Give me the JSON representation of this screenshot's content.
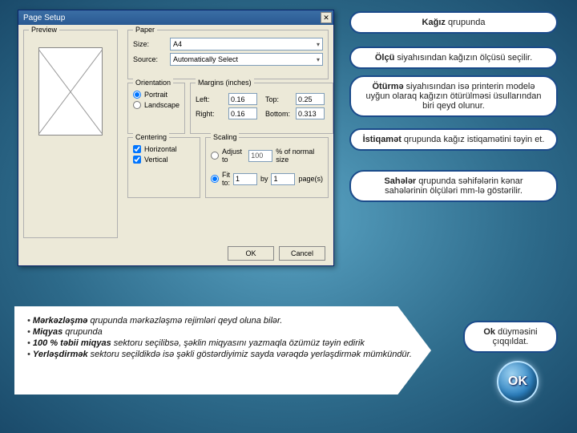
{
  "dialog": {
    "title": "Page Setup",
    "preview_label": "Preview",
    "paper": {
      "label": "Paper",
      "size_label": "Size:",
      "size_value": "A4",
      "source_label": "Source:",
      "source_value": "Automatically Select"
    },
    "orientation": {
      "label": "Orientation",
      "portrait": "Portrait",
      "landscape": "Landscape"
    },
    "margins": {
      "label": "Margins (inches)",
      "left_label": "Left:",
      "left_val": "0.16",
      "right_label": "Right:",
      "right_val": "0.16",
      "top_label": "Top:",
      "top_val": "0.25",
      "bottom_label": "Bottom:",
      "bottom_val": "0.313"
    },
    "centering": {
      "label": "Centering",
      "horizontal": "Horizontal",
      "vertical": "Vertical"
    },
    "scaling": {
      "label": "Scaling",
      "adjust": "Adjust to",
      "adjust_val": "100",
      "adjust_suffix": "% of normal size",
      "fit": "Fit to:",
      "fit_w": "1",
      "fit_by": "by",
      "fit_h": "1",
      "fit_suffix": "page(s)"
    },
    "ok": "OK",
    "cancel": "Cancel"
  },
  "callouts": {
    "c1_bold": "Kağız",
    "c1_rest": " qrupunda",
    "c2_bold": "Ölçü",
    "c2_rest": " siyahısından kağızın ölçüsü seçilir.",
    "c3_bold": "Ötürmə",
    "c3_rest": " siyahısından isə printerin modelə uyğun olaraq kağızın ötürülməsi üsullarından biri qeyd olunur.",
    "c4_bold": "İstiqamət",
    "c4_rest": " qrupunda kağız istiqamətini təyin et.",
    "c5_bold": "Sahələr",
    "c5_rest": " qrupunda səhifələrin kənar sahələrinin ölçüləri mm-lə göstərilir.",
    "c6_bold": "Ok",
    "c6_rest": " düyməsini çıqqıldat."
  },
  "notes": {
    "n1b": "Mərkəzləşmə",
    "n1": " qrupunda mərkəzləşmə rejimləri qeyd oluna bilər.",
    "n2b": "Miqyas",
    "n2": " qrupunda",
    "n3b": "100 % təbii miqyas",
    "n3": " sektoru seçilibsə, şəklin miqyasını yazmaqla özümüz təyin edirik",
    "n4b": "Yerləşdirmək",
    "n4": " sektoru seçildikdə isə şəkli göstərdiyimiz sayda vərəqdə yerləşdirmək mümkündür."
  },
  "okicon": "OK"
}
